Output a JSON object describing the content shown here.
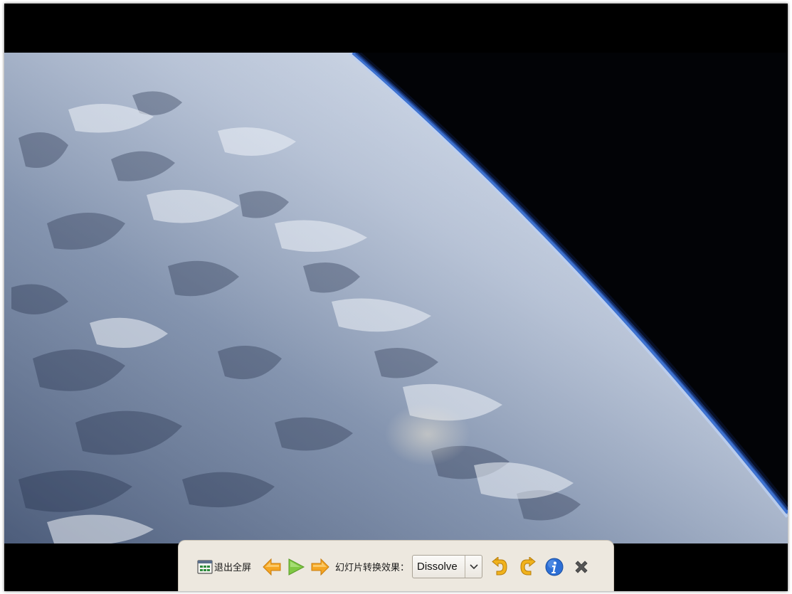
{
  "viewer": {
    "photo": {
      "subject": "earth-limb-from-space"
    },
    "toolbar": {
      "exit_fullscreen_label": "退出全屏",
      "transition_label": "幻灯片转换效果：",
      "transition_select": {
        "selected": "Dissolve"
      },
      "icons": {
        "exit_fullscreen": "fullscreen-icon",
        "previous": "arrow-left-icon",
        "play": "play-icon",
        "next": "arrow-right-icon",
        "dropdown": "chevron-down-icon",
        "rotate_left": "rotate-left-icon",
        "rotate_right": "rotate-right-icon",
        "info": "info-icon",
        "close": "close-icon"
      }
    }
  },
  "colors": {
    "toolbar_bg": "#ede8df",
    "arrow_orange": "#f5a623",
    "play_green": "#7fc843",
    "info_blue": "#2d6fd6",
    "close_gray": "#555555",
    "space": "#020306",
    "atmosphere": "#3f73d0"
  }
}
